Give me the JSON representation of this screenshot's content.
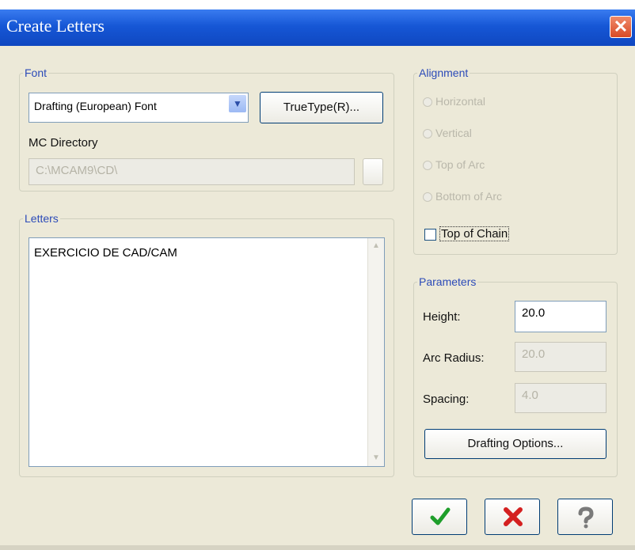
{
  "window": {
    "title": "Create Letters"
  },
  "font_group": {
    "legend": "Font",
    "font_select": {
      "value": "Drafting (European) Font"
    },
    "truetype_button": "TrueType(R)...",
    "mc_directory_label": "MC Directory",
    "mc_directory_value": "C:\\MCAM9\\CD\\"
  },
  "letters_group": {
    "legend": "Letters",
    "text": "EXERCICIO DE CAD/CAM"
  },
  "alignment_group": {
    "legend": "Alignment",
    "options": [
      {
        "label": "Horizontal",
        "selected": true,
        "enabled": false
      },
      {
        "label": "Vertical",
        "selected": false,
        "enabled": false
      },
      {
        "label": "Top of Arc",
        "selected": false,
        "enabled": false
      },
      {
        "label": "Bottom of Arc",
        "selected": false,
        "enabled": false
      }
    ],
    "top_of_chain": {
      "label": "Top of Chain",
      "checked": false
    }
  },
  "parameters_group": {
    "legend": "Parameters",
    "height": {
      "label": "Height:",
      "value": "20.0"
    },
    "arc_radius": {
      "label": "Arc Radius:",
      "value": "20.0"
    },
    "spacing": {
      "label": "Spacing:",
      "value": "4.0"
    },
    "drafting_options_button": "Drafting Options..."
  },
  "footer": {
    "ok_icon": "checkmark-icon",
    "cancel_icon": "cancel-x-icon",
    "help_icon": "help-question-icon"
  }
}
